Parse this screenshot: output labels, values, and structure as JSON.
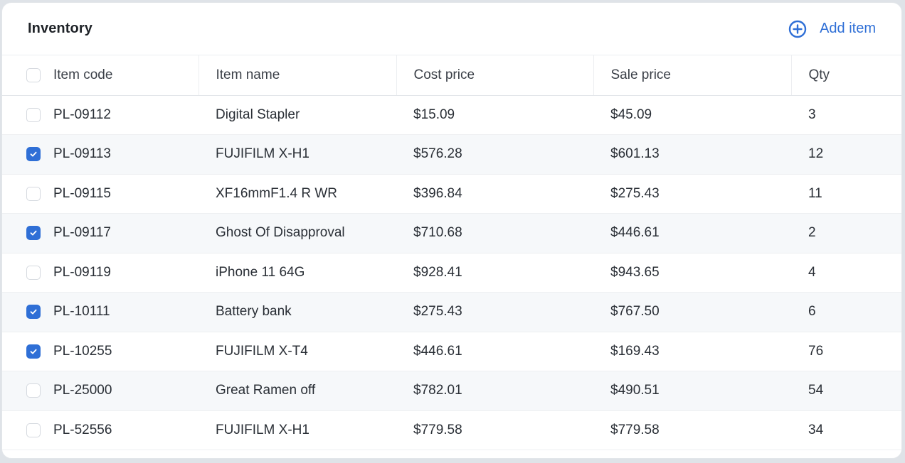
{
  "header": {
    "title": "Inventory",
    "add_label": "Add item"
  },
  "table": {
    "columns": [
      "Item code",
      "Item name",
      "Cost price",
      "Sale price",
      "Qty"
    ],
    "rows": [
      {
        "checked": false,
        "code": "PL-09112",
        "name": "Digital Stapler",
        "cost": "$15.09",
        "sale": "$45.09",
        "qty": "3"
      },
      {
        "checked": true,
        "code": "PL-09113",
        "name": "FUJIFILM X-H1",
        "cost": "$576.28",
        "sale": "$601.13",
        "qty": "12"
      },
      {
        "checked": false,
        "code": "PL-09115",
        "name": "XF16mmF1.4 R WR",
        "cost": "$396.84",
        "sale": "$275.43",
        "qty": "11"
      },
      {
        "checked": true,
        "code": "PL-09117",
        "name": "Ghost Of Disapproval",
        "cost": "$710.68",
        "sale": "$446.61",
        "qty": "2"
      },
      {
        "checked": false,
        "code": "PL-09119",
        "name": "iPhone 11 64G",
        "cost": "$928.41",
        "sale": "$943.65",
        "qty": "4"
      },
      {
        "checked": true,
        "code": "PL-10111",
        "name": "Battery bank",
        "cost": "$275.43",
        "sale": "$767.50",
        "qty": "6"
      },
      {
        "checked": true,
        "code": "PL-10255",
        "name": "FUJIFILM X-T4",
        "cost": "$446.61",
        "sale": "$169.43",
        "qty": "76"
      },
      {
        "checked": false,
        "code": "PL-25000",
        "name": "Great Ramen off",
        "cost": "$782.01",
        "sale": "$490.51",
        "qty": "54"
      },
      {
        "checked": false,
        "code": "PL-52556",
        "name": "FUJIFILM X-H1",
        "cost": "$779.58",
        "sale": "$779.58",
        "qty": "34"
      }
    ]
  },
  "colors": {
    "accent": "#2f6fd6",
    "row_alt": "#f6f8fa"
  },
  "icons": {
    "add": "plus-circle-icon",
    "check": "checkmark-icon"
  }
}
